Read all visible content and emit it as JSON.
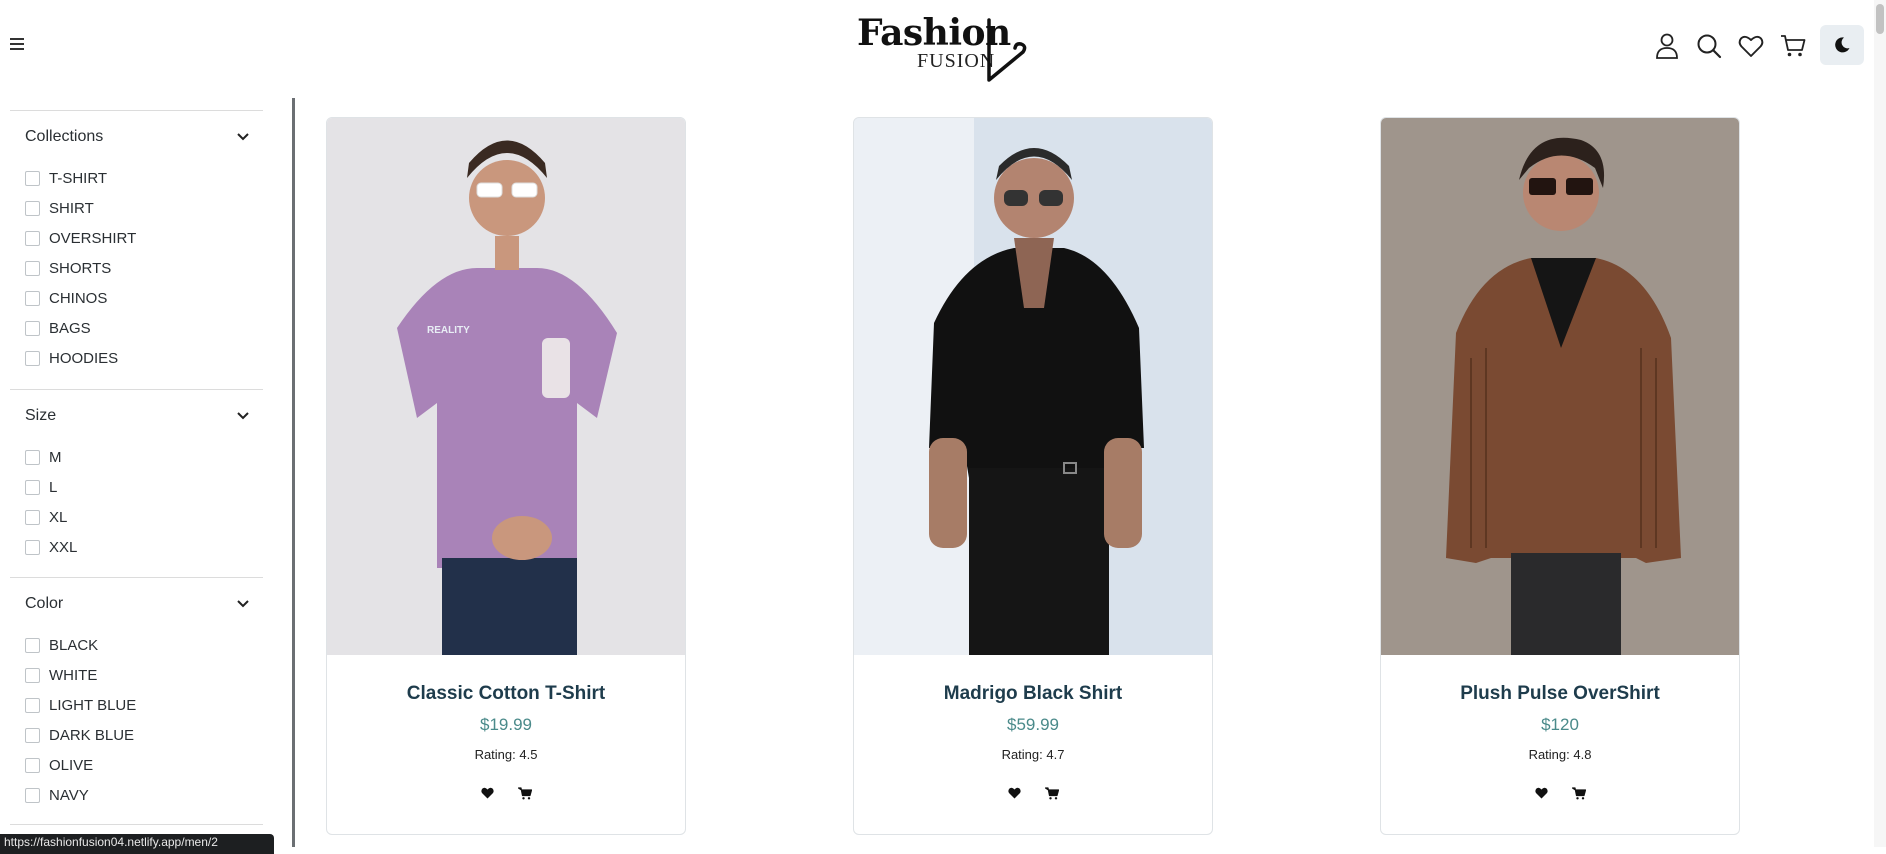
{
  "header": {
    "logo_main": "Fashion",
    "logo_sub": "FUSION",
    "icons": [
      "user-icon",
      "search-icon",
      "heart-icon",
      "cart-icon"
    ],
    "theme_icon": "moon-icon"
  },
  "sidebar": {
    "groups": [
      {
        "title": "Collections",
        "options": [
          "T-SHIRT",
          "SHIRT",
          "OVERSHIRT",
          "SHORTS",
          "CHINOS",
          "BAGS",
          "HOODIES"
        ]
      },
      {
        "title": "Size",
        "options": [
          "M",
          "L",
          "XL",
          "XXL"
        ]
      },
      {
        "title": "Color",
        "options": [
          "BLACK",
          "WHITE",
          "LIGHT BLUE",
          "DARK BLUE",
          "OLIVE",
          "NAVY"
        ]
      }
    ]
  },
  "products": [
    {
      "name": "Classic Cotton T-Shirt",
      "price": "$19.99",
      "rating": "Rating: 4.5"
    },
    {
      "name": "Madrigo Black Shirt",
      "price": "$59.99",
      "rating": "Rating: 4.7"
    },
    {
      "name": "Plush Pulse OverShirt",
      "price": "$120",
      "rating": "Rating: 4.8"
    }
  ],
  "status_bar": {
    "url": "https://fashionfusion04.netlify.app/men/2"
  },
  "colors": {
    "accent": "#1e3c4c",
    "price": "#4a8a8a",
    "sidebar_border": "#6b6f73"
  }
}
